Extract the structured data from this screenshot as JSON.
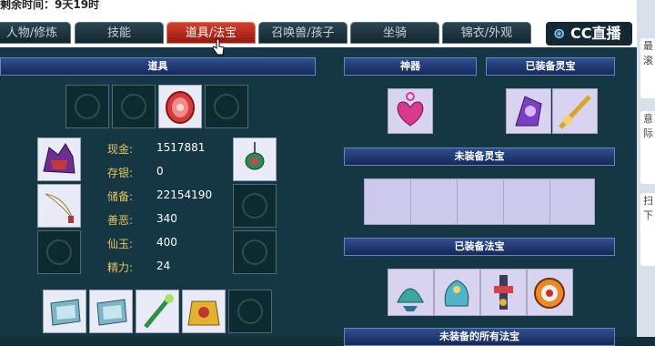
{
  "top": {
    "remaining_text": "剩余时间：9天19时"
  },
  "tabs": [
    {
      "label": "人物/修炼",
      "active": false
    },
    {
      "label": "技能",
      "active": false
    },
    {
      "label": "道具/法宝",
      "active": true
    },
    {
      "label": "召唤兽/孩子",
      "active": false
    },
    {
      "label": "坐骑",
      "active": false
    },
    {
      "label": "锦衣/外观",
      "active": false
    }
  ],
  "watermark": "CC直播",
  "sections": {
    "items": "道具",
    "artifact": "神器",
    "equipped_spirit": "已装备灵宝",
    "unequipped_spirit": "未装备灵宝",
    "equipped_treasure": "已装备法宝",
    "all_treasures": "未装备的所有法宝"
  },
  "stats": [
    {
      "label": "现金:",
      "value": "1517881"
    },
    {
      "label": "存银:",
      "value": "0"
    },
    {
      "label": "储备:",
      "value": "22154190"
    },
    {
      "label": "善恶:",
      "value": "340"
    },
    {
      "label": "仙玉:",
      "value": "400"
    },
    {
      "label": "精力:",
      "value": "24"
    }
  ],
  "sidebar": {
    "card1": "最 滚",
    "card2": "意 际",
    "card3": "扫 下"
  },
  "icons": {
    "top_slots": [
      "empty-slot-icon",
      "empty-slot-icon",
      "red-gem-icon",
      "empty-slot-icon"
    ],
    "left_slots": [
      "dragon-helmet-icon",
      "curved-blade-icon",
      "empty-slot-icon"
    ],
    "right_slots": [
      "jade-pendant-icon",
      "empty-slot-icon",
      "empty-slot-icon"
    ],
    "bottom_slots": [
      "armor-icon",
      "armor-icon",
      "jade-staff-icon",
      "golden-armor-icon",
      "empty-slot-icon"
    ],
    "artifact": "heart-pendant-icon",
    "equipped_spirit": [
      "purple-mirror-icon",
      "golden-sword-icon"
    ],
    "equipped_treasure": [
      "lotus-icon",
      "blue-dragon-icon",
      "bell-tower-icon",
      "fire-drum-icon"
    ]
  }
}
